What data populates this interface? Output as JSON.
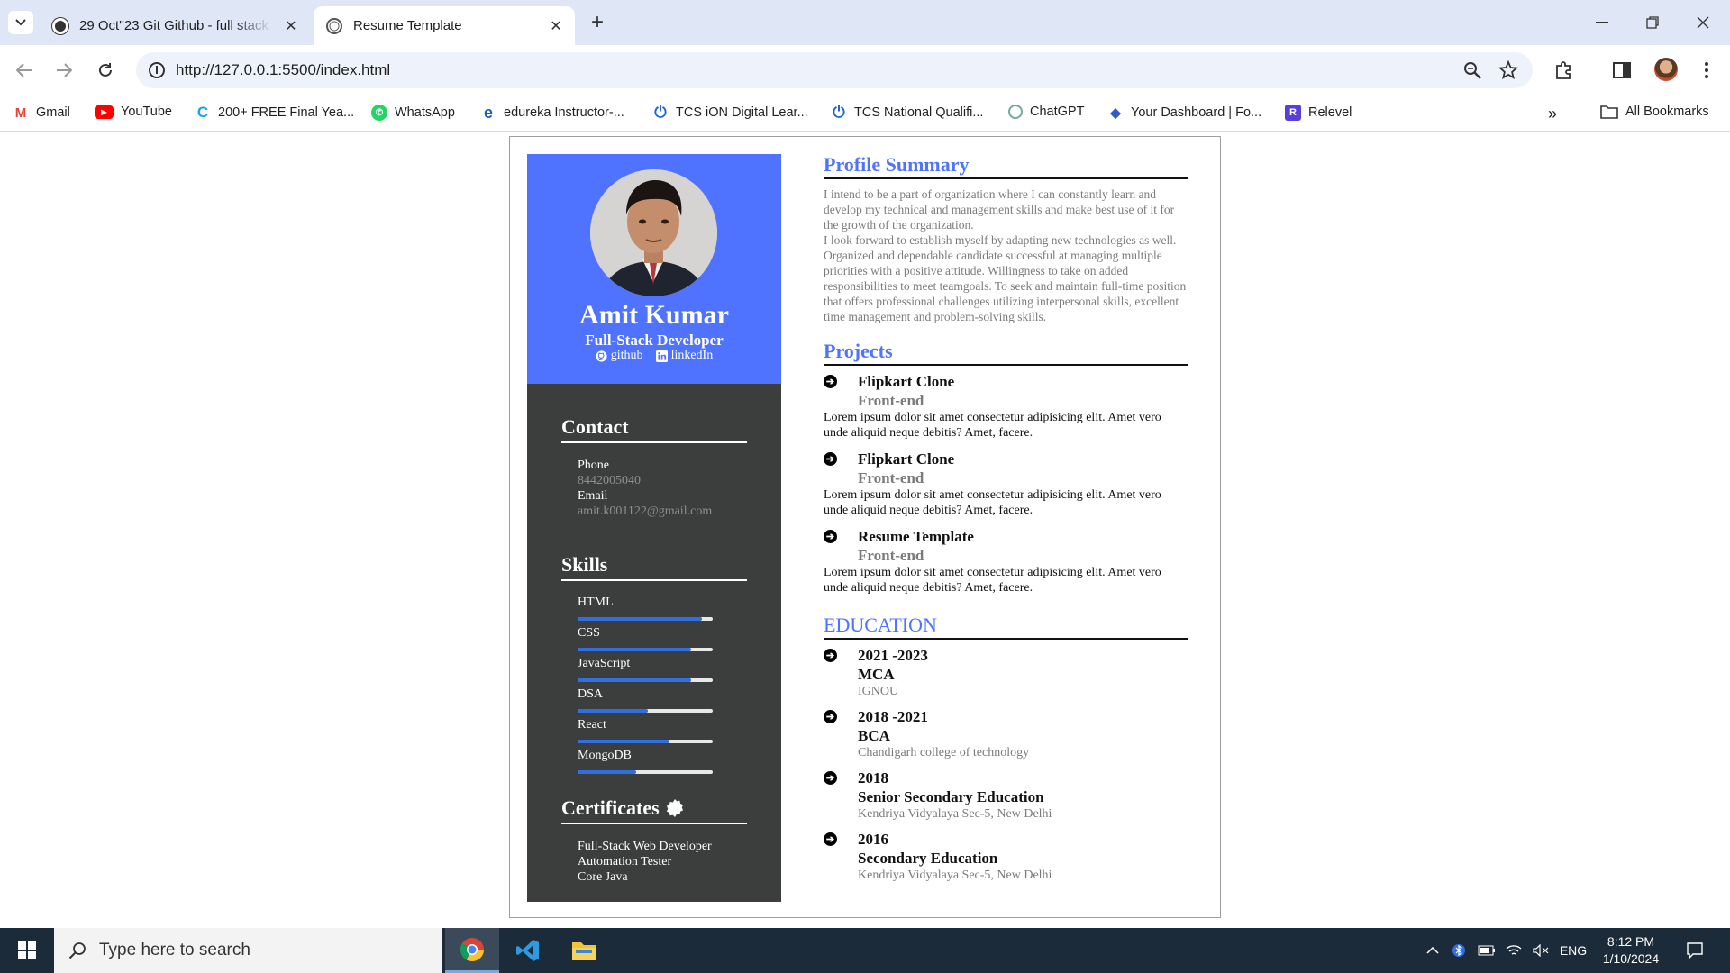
{
  "browser": {
    "tabs": [
      {
        "title": "29 Oct''23 Git Github - full stack",
        "active": false
      },
      {
        "title": "Resume Template",
        "active": true
      }
    ],
    "url": "http://127.0.0.1:5500/index.html",
    "bookmarks": [
      {
        "label": "Gmail",
        "icon": "gmail-icon",
        "color": "#ea4335"
      },
      {
        "label": "YouTube",
        "icon": "youtube-icon",
        "color": "#ff0000"
      },
      {
        "label": "200+ FREE Final Yea...",
        "icon": "c-logo-icon",
        "color": "#1aa3e8"
      },
      {
        "label": "WhatsApp",
        "icon": "whatsapp-icon",
        "color": "#25d366"
      },
      {
        "label": "edureka Instructor-...",
        "icon": "edureka-icon",
        "color": "#1b5fb5"
      },
      {
        "label": "TCS iON Digital Lear...",
        "icon": "power-icon",
        "color": "#1b63d6"
      },
      {
        "label": "TCS National Qualifi...",
        "icon": "power-icon",
        "color": "#1b63d6"
      },
      {
        "label": "ChatGPT",
        "icon": "chatgpt-icon",
        "color": "#74aa9c"
      },
      {
        "label": "Your Dashboard | Fo...",
        "icon": "dashboard-icon",
        "color": "#2f5bd3"
      },
      {
        "label": "Relevel",
        "icon": "relevel-icon",
        "color": "#5b3ddb"
      }
    ],
    "all_bookmarks": "All Bookmarks"
  },
  "resume": {
    "name": "Amit Kumar",
    "role": "Full-Stack Developer",
    "links": {
      "github": "github",
      "linkedin": "linkedIn"
    },
    "contact": {
      "heading": "Contact",
      "phone_label": "Phone",
      "phone": "8442005040",
      "email_label": "Email",
      "email": "amit.k001122@gmail.com"
    },
    "skills": {
      "heading": "Skills",
      "items": [
        {
          "name": "HTML",
          "level": 0.92
        },
        {
          "name": "CSS",
          "level": 0.84
        },
        {
          "name": "JavaScript",
          "level": 0.84
        },
        {
          "name": "DSA",
          "level": 0.52
        },
        {
          "name": "React",
          "level": 0.68
        },
        {
          "name": "MongoDB",
          "level": 0.43
        }
      ]
    },
    "certificates": {
      "heading": "Certificates",
      "items": [
        "Full-Stack Web Developer",
        "Automation Tester",
        "Core Java"
      ]
    },
    "summary": {
      "heading": "Profile Summary",
      "text": "I intend to be a part of organization where I can constantly learn and develop my technical and management skills and make best use of it for the growth of the organization.\nI look forward to establish myself by adapting new technologies as well. Organized and dependable candidate successful at managing multiple priorities with a positive attitude. Willingness to take on added responsibilities to meet teamgoals. To seek and maintain full-time position that offers professional challenges utilizing interpersonal skills, excellent time management and problem-solving skills."
    },
    "projects": {
      "heading": "Projects",
      "items": [
        {
          "title": "Flipkart Clone",
          "type": "Front-end",
          "desc": "Lorem ipsum dolor sit amet consectetur adipisicing elit. Amet vero unde aliquid neque debitis? Amet, facere."
        },
        {
          "title": "Flipkart Clone",
          "type": "Front-end",
          "desc": "Lorem ipsum dolor sit amet consectetur adipisicing elit. Amet vero unde aliquid neque debitis? Amet, facere."
        },
        {
          "title": "Resume Template",
          "type": "Front-end",
          "desc": "Lorem ipsum dolor sit amet consectetur adipisicing elit. Amet vero unde aliquid neque debitis? Amet, facere."
        }
      ]
    },
    "education": {
      "heading": "EDUCATION",
      "items": [
        {
          "year": "2021 -2023",
          "degree": "MCA",
          "institute": "IGNOU"
        },
        {
          "year": "2018 -2021",
          "degree": "BCA",
          "institute": "Chandigarh college of technology"
        },
        {
          "year": "2018",
          "degree": "Senior Secondary Education",
          "institute": "Kendriya Vidyalaya Sec-5, New Delhi"
        },
        {
          "year": "2016",
          "degree": "Secondary Education",
          "institute": "Kendriya Vidyalaya Sec-5, New Delhi"
        }
      ]
    }
  },
  "taskbar": {
    "search_placeholder": "Type here to search",
    "language": "ENG",
    "time": "8:12 PM",
    "date": "1/10/2024"
  },
  "colors": {
    "accent": "#4f73ff",
    "sidebar": "#3b3e3d",
    "skill_fill": "#2f6fe0"
  }
}
